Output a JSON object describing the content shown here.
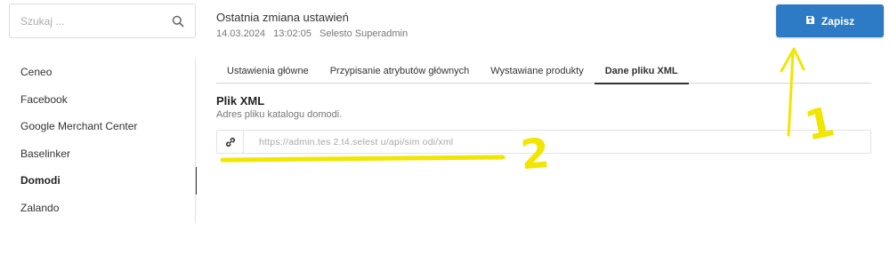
{
  "search": {
    "placeholder": "Szukaj ..."
  },
  "header": {
    "title": "Ostatnia zmiana ustawień",
    "date": "14.03.2024",
    "time": "13:02:05",
    "user": "Selesto Superadmin"
  },
  "toolbar": {
    "save_label": "Zapisz"
  },
  "sidebar": {
    "items": [
      {
        "label": "Ceneo"
      },
      {
        "label": "Facebook"
      },
      {
        "label": "Google Merchant Center"
      },
      {
        "label": "Baselinker"
      },
      {
        "label": "Domodi"
      },
      {
        "label": "Zalando"
      }
    ],
    "active_index": 4
  },
  "tabs": [
    {
      "label": "Ustawienia główne"
    },
    {
      "label": "Przypisanie atrybutów głównych"
    },
    {
      "label": "Wystawiane produkty"
    },
    {
      "label": "Dane pliku XML"
    }
  ],
  "active_tab": 3,
  "xml": {
    "title": "Plik XML",
    "description": "Adres pliku katalogu domodi.",
    "url": "https://admin.tes     2.t4.selest      u/api/sim       odi/xml"
  },
  "annotations": {
    "mark1": "1",
    "mark2": "2"
  },
  "colors": {
    "accent": "#2d7bc4",
    "annotation": "#f2e500"
  }
}
